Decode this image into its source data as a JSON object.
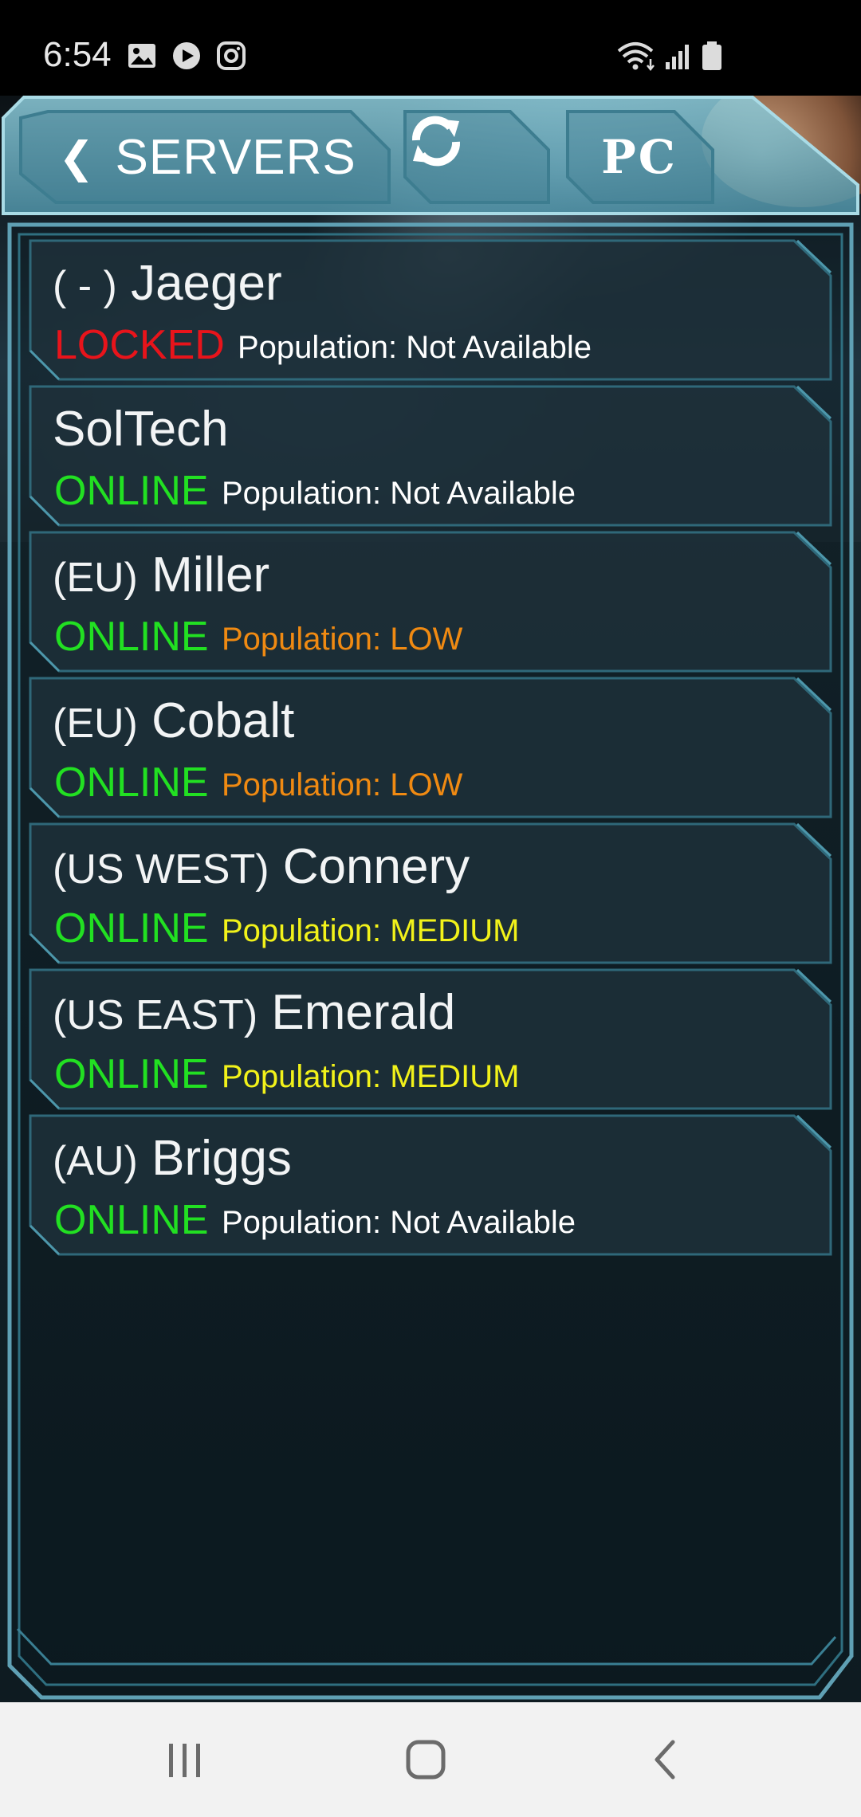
{
  "status_bar": {
    "time": "6:54",
    "left_icons": [
      "image-icon",
      "play-circle-icon",
      "instagram-icon"
    ],
    "right_icons": [
      "wifi-icon",
      "signal-icon",
      "battery-icon"
    ]
  },
  "header": {
    "back_chevron": "❮",
    "back_label": "SERVERS",
    "refresh_icon": "refresh-icon",
    "platform_label": "PC"
  },
  "servers": [
    {
      "region": "( - )",
      "name": "Jaeger",
      "status": "LOCKED",
      "population": "Population: Not Available",
      "status_color": "#e8141b",
      "population_color": "#ffffff"
    },
    {
      "region": "",
      "name": "SolTech",
      "status": "ONLINE",
      "population": "Population: Not Available",
      "status_color": "#22e022",
      "population_color": "#ffffff"
    },
    {
      "region": "(EU)",
      "name": "Miller",
      "status": "ONLINE",
      "population": "Population: LOW",
      "status_color": "#22e022",
      "population_color": "#f08a12"
    },
    {
      "region": "(EU)",
      "name": "Cobalt",
      "status": "ONLINE",
      "population": "Population: LOW",
      "status_color": "#22e022",
      "population_color": "#f08a12"
    },
    {
      "region": "(US WEST)",
      "name": "Connery",
      "status": "ONLINE",
      "population": "Population: MEDIUM",
      "status_color": "#22e022",
      "population_color": "#f2f21a"
    },
    {
      "region": "(US EAST)",
      "name": "Emerald",
      "status": "ONLINE",
      "population": "Population: MEDIUM",
      "status_color": "#22e022",
      "population_color": "#f2f21a"
    },
    {
      "region": "(AU)",
      "name": "Briggs",
      "status": "ONLINE",
      "population": "Population: Not Available",
      "status_color": "#22e022",
      "population_color": "#ffffff"
    }
  ],
  "nav_bar": {
    "recents_icon": "recents-icon",
    "home_icon": "home-icon",
    "back_icon": "back-icon"
  },
  "colors": {
    "frame": "#5fa0b4",
    "header_fill": "#6fb3c6",
    "card_fill": "#1e313a"
  }
}
